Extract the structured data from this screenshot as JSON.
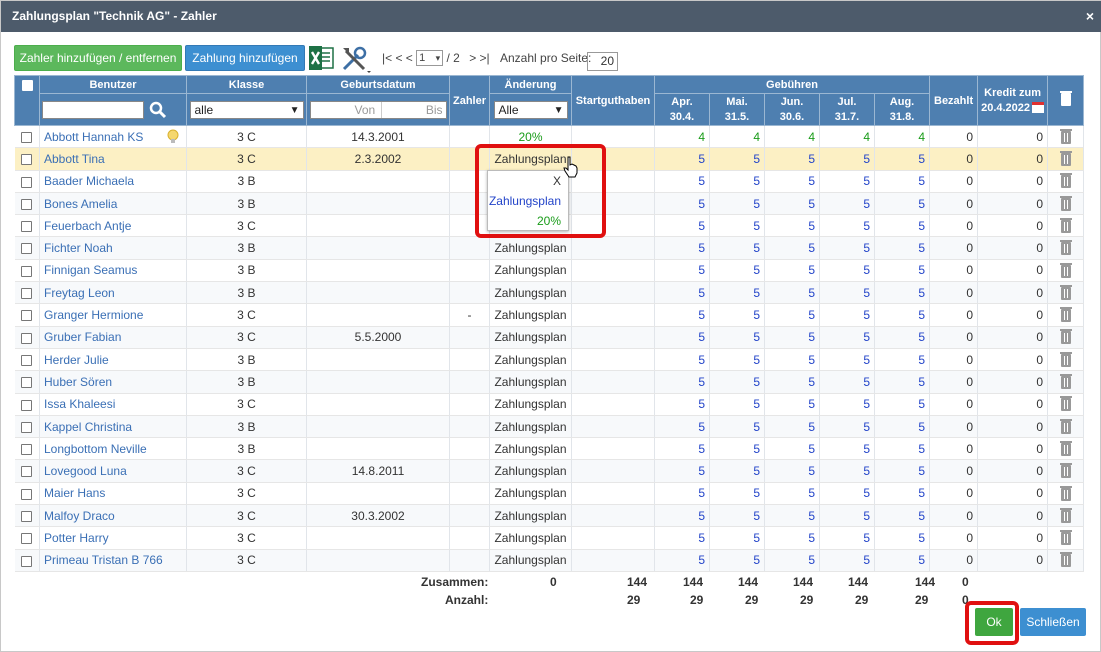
{
  "window": {
    "title": "Zahlungsplan \"Technik AG\" - Zahler",
    "close_label": "×"
  },
  "toolbar": {
    "add_remove_payer": "Zahler hinzufügen / entfernen",
    "add_payment": "Zahlung hinzufügen",
    "first_prev": "|< < <",
    "page_current": "1",
    "page_total": "/ 2",
    "next_last": "> >|",
    "per_page_label": "Anzahl pro Seite:",
    "per_page_value": "20"
  },
  "header": {
    "benutzer": "Benutzer",
    "klasse": "Klasse",
    "geburtsdatum": "Geburtsdatum",
    "zahler": "Zahler",
    "aenderung": "Änderung",
    "startguthaben": "Startguthaben",
    "gebuehren": "Gebühren",
    "bezahlt": "Bezahlt",
    "kredit_line1": "Kredit zum",
    "kredit_line2": "20.4.2022",
    "months": [
      {
        "l1": "Apr.",
        "l2": "30.4."
      },
      {
        "l1": "Mai.",
        "l2": "31.5."
      },
      {
        "l1": "Jun.",
        "l2": "30.6."
      },
      {
        "l1": "Jul.",
        "l2": "31.7."
      },
      {
        "l1": "Aug.",
        "l2": "31.8."
      }
    ]
  },
  "filters": {
    "klasse_value": "alle",
    "von_placeholder": "Von",
    "bis_placeholder": "Bis",
    "aenderung_value": "Alle"
  },
  "rows": [
    {
      "name": "Abbott Hannah KS",
      "klasse": "3 C",
      "geb": "14.3.2001",
      "zahler": "",
      "aend": "20%",
      "aend_green": true,
      "fees": [
        "4",
        "4",
        "4",
        "4",
        "4"
      ],
      "fees_green": true,
      "bezahlt": "0",
      "kredit": "0"
    },
    {
      "name": "Abbott Tina",
      "klasse": "3 C",
      "geb": "2.3.2002",
      "zahler": "",
      "aend": "Zahlungsplan",
      "fees": [
        "5",
        "5",
        "5",
        "5",
        "5"
      ],
      "bezahlt": "0",
      "kredit": "0"
    },
    {
      "name": "Baader Michaela",
      "klasse": "3 B",
      "geb": "",
      "zahler": "",
      "aend": "",
      "fees": [
        "5",
        "5",
        "5",
        "5",
        "5"
      ],
      "bezahlt": "0",
      "kredit": "0"
    },
    {
      "name": "Bones Amelia",
      "klasse": "3 B",
      "geb": "",
      "zahler": "",
      "aend": "",
      "fees": [
        "5",
        "5",
        "5",
        "5",
        "5"
      ],
      "bezahlt": "0",
      "kredit": "0"
    },
    {
      "name": "Feuerbach Antje",
      "klasse": "3 C",
      "geb": "",
      "zahler": "",
      "aend": "",
      "fees": [
        "5",
        "5",
        "5",
        "5",
        "5"
      ],
      "bezahlt": "0",
      "kredit": "0"
    },
    {
      "name": "Fichter Noah",
      "klasse": "3 B",
      "geb": "",
      "zahler": "",
      "aend": "Zahlungsplan",
      "fees": [
        "5",
        "5",
        "5",
        "5",
        "5"
      ],
      "bezahlt": "0",
      "kredit": "0"
    },
    {
      "name": "Finnigan Seamus",
      "klasse": "3 B",
      "geb": "",
      "zahler": "",
      "aend": "Zahlungsplan",
      "fees": [
        "5",
        "5",
        "5",
        "5",
        "5"
      ],
      "bezahlt": "0",
      "kredit": "0"
    },
    {
      "name": "Freytag Leon",
      "klasse": "3 B",
      "geb": "",
      "zahler": "",
      "aend": "Zahlungsplan",
      "fees": [
        "5",
        "5",
        "5",
        "5",
        "5"
      ],
      "bezahlt": "0",
      "kredit": "0"
    },
    {
      "name": "Granger Hermione",
      "klasse": "3 C",
      "geb": "",
      "zahler": "-",
      "aend": "Zahlungsplan",
      "fees": [
        "5",
        "5",
        "5",
        "5",
        "5"
      ],
      "bezahlt": "0",
      "kredit": "0"
    },
    {
      "name": "Gruber Fabian",
      "klasse": "3 C",
      "geb": "5.5.2000",
      "zahler": "",
      "aend": "Zahlungsplan",
      "fees": [
        "5",
        "5",
        "5",
        "5",
        "5"
      ],
      "bezahlt": "0",
      "kredit": "0"
    },
    {
      "name": "Herder Julie",
      "klasse": "3 B",
      "geb": "",
      "zahler": "",
      "aend": "Zahlungsplan",
      "fees": [
        "5",
        "5",
        "5",
        "5",
        "5"
      ],
      "bezahlt": "0",
      "kredit": "0"
    },
    {
      "name": "Huber Sören",
      "klasse": "3 B",
      "geb": "",
      "zahler": "",
      "aend": "Zahlungsplan",
      "fees": [
        "5",
        "5",
        "5",
        "5",
        "5"
      ],
      "bezahlt": "0",
      "kredit": "0"
    },
    {
      "name": "Issa Khaleesi",
      "klasse": "3 C",
      "geb": "",
      "zahler": "",
      "aend": "Zahlungsplan",
      "fees": [
        "5",
        "5",
        "5",
        "5",
        "5"
      ],
      "bezahlt": "0",
      "kredit": "0"
    },
    {
      "name": "Kappel Christina",
      "klasse": "3 B",
      "geb": "",
      "zahler": "",
      "aend": "Zahlungsplan",
      "fees": [
        "5",
        "5",
        "5",
        "5",
        "5"
      ],
      "bezahlt": "0",
      "kredit": "0"
    },
    {
      "name": "Longbottom Neville",
      "klasse": "3 B",
      "geb": "",
      "zahler": "",
      "aend": "Zahlungsplan",
      "fees": [
        "5",
        "5",
        "5",
        "5",
        "5"
      ],
      "bezahlt": "0",
      "kredit": "0"
    },
    {
      "name": "Lovegood Luna",
      "klasse": "3 C",
      "geb": "14.8.2011",
      "zahler": "",
      "aend": "Zahlungsplan",
      "fees": [
        "5",
        "5",
        "5",
        "5",
        "5"
      ],
      "bezahlt": "0",
      "kredit": "0"
    },
    {
      "name": "Maier Hans",
      "klasse": "3 C",
      "geb": "",
      "zahler": "",
      "aend": "Zahlungsplan",
      "fees": [
        "5",
        "5",
        "5",
        "5",
        "5"
      ],
      "bezahlt": "0",
      "kredit": "0"
    },
    {
      "name": "Malfoy Draco",
      "klasse": "3 C",
      "geb": "30.3.2002",
      "zahler": "",
      "aend": "Zahlungsplan",
      "fees": [
        "5",
        "5",
        "5",
        "5",
        "5"
      ],
      "bezahlt": "0",
      "kredit": "0"
    },
    {
      "name": "Potter Harry",
      "klasse": "3 C",
      "geb": "",
      "zahler": "",
      "aend": "Zahlungsplan",
      "fees": [
        "5",
        "5",
        "5",
        "5",
        "5"
      ],
      "bezahlt": "0",
      "kredit": "0"
    },
    {
      "name": "Primeau Tristan B 766",
      "klasse": "3 C",
      "geb": "",
      "zahler": "",
      "aend": "Zahlungsplan",
      "fees": [
        "5",
        "5",
        "5",
        "5",
        "5"
      ],
      "bezahlt": "0",
      "kredit": "0"
    }
  ],
  "dropdown": {
    "x": "X",
    "option1": "Zahlungsplan",
    "option2": "20%"
  },
  "totals": {
    "sum_label": "Zusammen:",
    "count_label": "Anzahl:",
    "sum": {
      "aend": "0",
      "start": "144",
      "fees": [
        "144",
        "144",
        "144",
        "144",
        "144"
      ],
      "bezahlt": "0",
      "kredit": "0"
    },
    "count": {
      "start": "29",
      "fees": [
        "29",
        "29",
        "29",
        "29",
        "29"
      ],
      "bezahlt": "0"
    }
  },
  "footer": {
    "ok": "Ok",
    "close": "Schließen"
  },
  "colors": {
    "titlebar": "#4d5b6b",
    "header": "#4e7fb0",
    "highlight_row": "#fcf0c4",
    "callout": "#e01010"
  }
}
